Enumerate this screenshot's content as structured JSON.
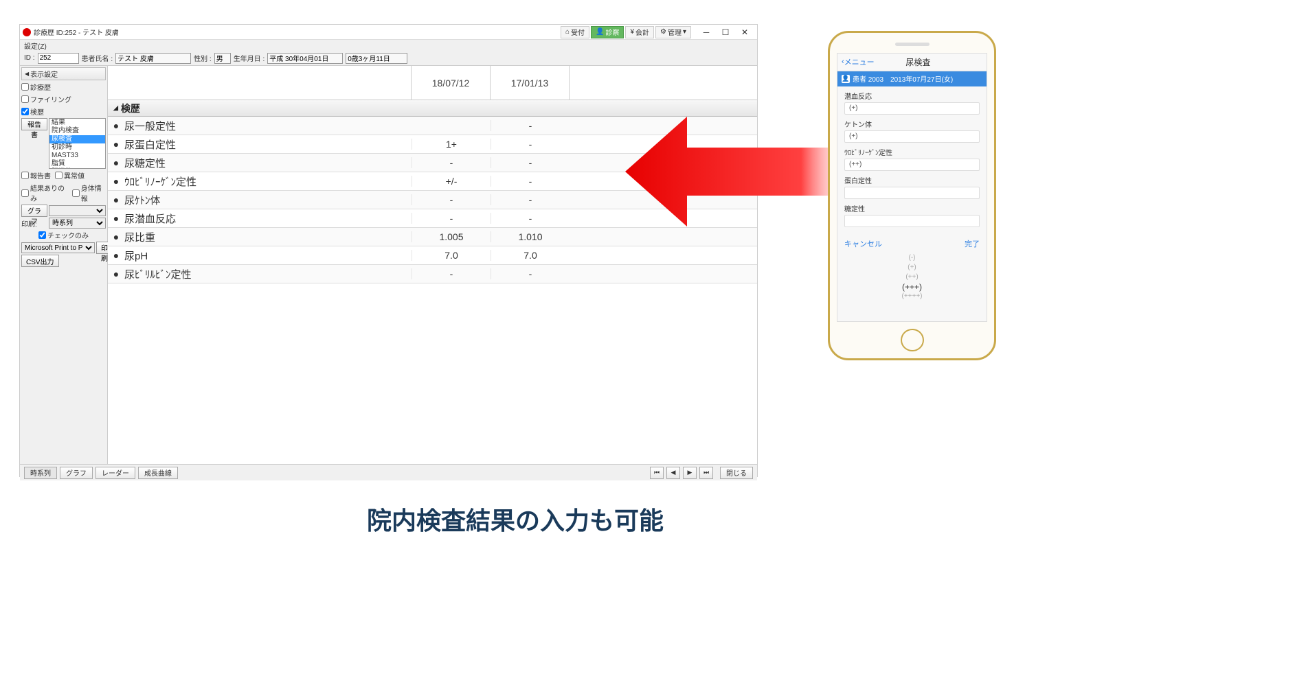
{
  "titlebar": {
    "title": "診療歴 ID:252 - テスト 皮膚",
    "tools": {
      "reception": "受付",
      "exam": "診察",
      "account": "会計",
      "manage": "管理"
    }
  },
  "menu": {
    "settings": "設定(Z)"
  },
  "info": {
    "id_lbl": "ID :",
    "id": "252",
    "name_lbl": "患者氏名 :",
    "name": "テスト 皮膚",
    "sex_lbl": "性別 :",
    "sex": "男",
    "dob_lbl": "生年月日 :",
    "dob": "平成 30年04月01日",
    "age": "0歳3ヶ月11日"
  },
  "sidebar": {
    "disp_hdr": "表示設定",
    "chk_chart": "診療歴",
    "chk_filing": "ファイリング",
    "chk_history": "検歴",
    "rpt_lbl": "報告書",
    "list": [
      "結果",
      "院内検査",
      "尿検査",
      "初診時",
      "MAST33",
      "脂質",
      "肝機能"
    ],
    "list_sel_idx": 2,
    "chk_report": "報告書",
    "chk_abnormal": "異常値",
    "chk_resultonly": "結果ありのみ",
    "chk_body": "身体情報",
    "graph_lbl": "グラフ",
    "print_lbl": "印刷:",
    "print_mode": "時系列",
    "chk_checkonly": "チェックのみ",
    "printer": "Microsoft Print to P",
    "print_btn": "印刷",
    "csv_btn": "CSV出力"
  },
  "grid": {
    "dates": [
      "18/07/12",
      "17/01/13"
    ],
    "section": "検歴",
    "rows": [
      {
        "name": "尿一般定性",
        "v": [
          "",
          "-"
        ]
      },
      {
        "name": "尿蛋白定性",
        "v": [
          "1+",
          "-"
        ]
      },
      {
        "name": "尿糖定性",
        "v": [
          "-",
          "-"
        ]
      },
      {
        "name": "ｳﾛﾋﾞﾘﾉｰｹﾞﾝ定性",
        "v": [
          "+/-",
          "-"
        ]
      },
      {
        "name": "尿ｹﾄﾝ体",
        "v": [
          "-",
          "-"
        ]
      },
      {
        "name": "尿潜血反応",
        "v": [
          "-",
          "-"
        ]
      },
      {
        "name": "尿比重",
        "v": [
          "1.005",
          "1.010"
        ]
      },
      {
        "name": "尿pH",
        "v": [
          "7.0",
          "7.0"
        ]
      },
      {
        "name": "尿ﾋﾞﾘﾙﾋﾞﾝ定性",
        "v": [
          "-",
          "-"
        ]
      }
    ]
  },
  "bottom": {
    "tabs": [
      "時系列",
      "グラフ",
      "レーダー",
      "成長曲線"
    ],
    "close": "閉じる"
  },
  "phone": {
    "back": "メニュー",
    "title": "尿検査",
    "patient": "患者 2003　2013年07月27日(女)",
    "items": [
      {
        "lbl": "潜血反応",
        "val": "(+)"
      },
      {
        "lbl": "ケトン体",
        "val": "(+)"
      },
      {
        "lbl": "ｳﾛﾋﾞﾘﾉｰｹﾞﾝ定性",
        "val": "(++)"
      },
      {
        "lbl": "蛋白定性",
        "val": ""
      },
      {
        "lbl": "糖定性",
        "val": ""
      }
    ],
    "cancel": "キャンセル",
    "done": "完了",
    "picker": [
      "(-)",
      "(+)",
      "(++)",
      "(+++)",
      "(++++)"
    ],
    "picker_cur": 3
  },
  "caption": "院内検査結果の入力も可能"
}
